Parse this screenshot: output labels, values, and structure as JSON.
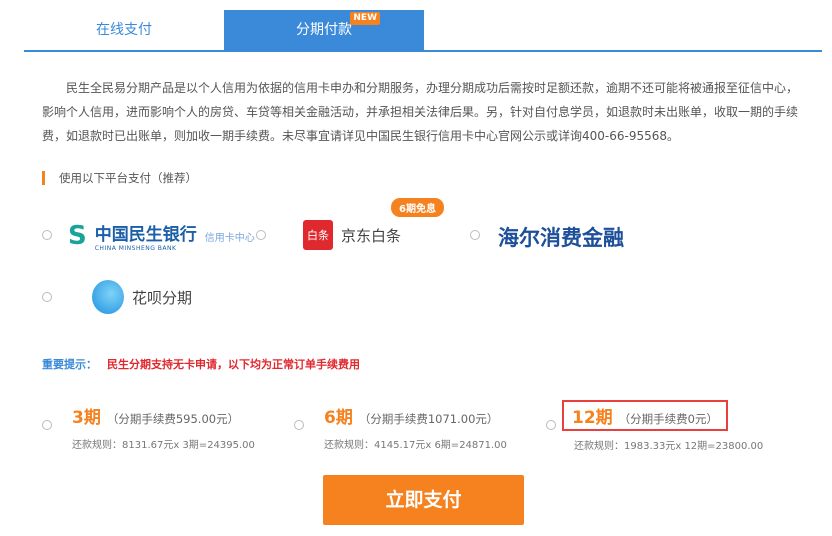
{
  "tabs": [
    {
      "label": "在线支付"
    },
    {
      "label": "分期付款",
      "badge": "NEW"
    }
  ],
  "description": "民生全民易分期产品是以个人信用为依据的信用卡申办和分期服务，办理分期成功后需按时足额还款，逾期不还可能将被通报至征信中心，影响个人信用，进而影响个人的房贷、车贷等相关金融活动，并承担相关法律后果。另，针对自付息学员，如退款时未出账单，收取一期的手续费，如退款时已出账单，则加收一期手续费。未尽事宜请详见中国民生银行信用卡中心官网公示或详询400-66-95568。",
  "section_title": "使用以下平台支付（推荐）",
  "platforms": [
    {
      "name": "中国民生银行",
      "sub": "CHINA MINSHENG BANK",
      "extra": "信用卡中心"
    },
    {
      "name": "京东白条",
      "icon_text": "白条",
      "badge": "6期免息"
    },
    {
      "name": "海尔消费金融"
    },
    {
      "name": "花呗分期"
    }
  ],
  "notice": {
    "label": "重要提示：",
    "text": "民生分期支持无卡申请，以下均为正常订单手续费用"
  },
  "plans": [
    {
      "term": "3期",
      "fee": "（分期手续费595.00元）",
      "rule": "还款规则：8131.67元x 3期=24395.00"
    },
    {
      "term": "6期",
      "fee": "（分期手续费1071.00元）",
      "rule": "还款规则：4145.17元x 6期=24871.00"
    },
    {
      "term": "12期",
      "fee": "（分期手续费0元）",
      "rule": "还款规则：1983.33元x 12期=23800.00"
    }
  ],
  "pay_button": "立即支付",
  "colors": {
    "accent": "#3a8ad9",
    "orange": "#f5821f",
    "red": "#e0282f"
  }
}
